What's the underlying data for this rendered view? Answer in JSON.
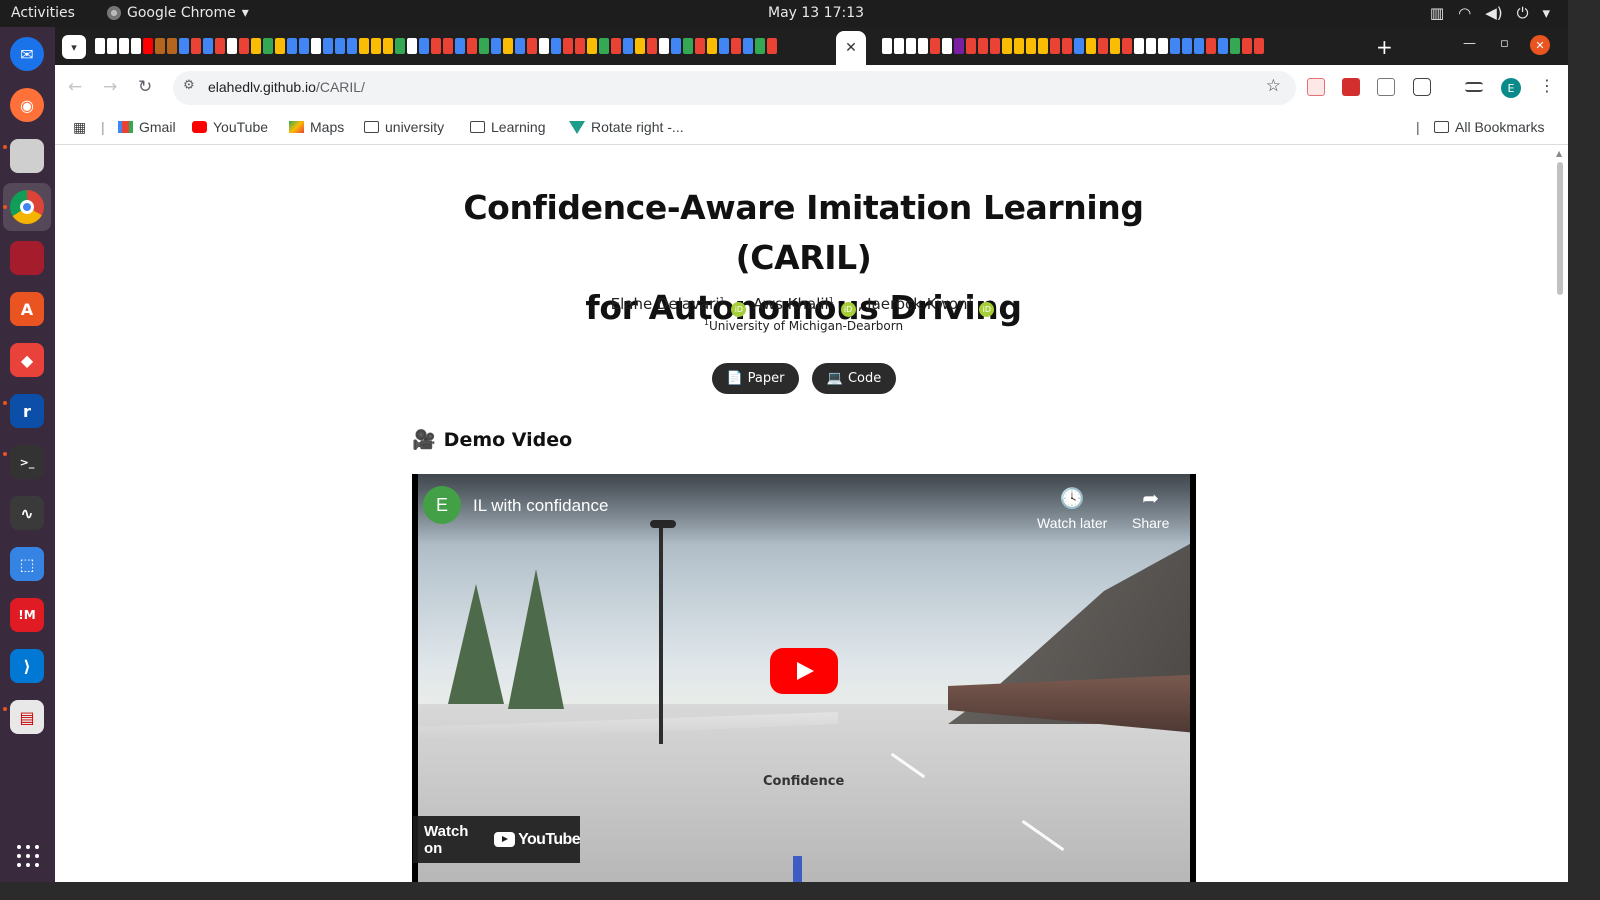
{
  "system": {
    "activities_label": "Activities",
    "app_menu_label": "Google Chrome",
    "clock": "May 13  17:13"
  },
  "browser": {
    "url_host": "elahedlv.github.io",
    "url_path": "/CARIL/",
    "profile_initial": "E",
    "bookmarks": [
      {
        "label": "Gmail",
        "icon": "gmail-icon"
      },
      {
        "label": "YouTube",
        "icon": "youtube-icon"
      },
      {
        "label": "Maps",
        "icon": "maps-icon"
      },
      {
        "label": "university",
        "icon": "folder-icon"
      },
      {
        "label": "Learning",
        "icon": "folder-icon"
      },
      {
        "label": "Rotate right -...",
        "icon": "vuetify-icon"
      }
    ],
    "all_bookmarks_label": "All Bookmarks"
  },
  "page": {
    "title_line1": "Confidence-Aware Imitation Learning (CARIL)",
    "title_line2": "for Autonomous Driving",
    "authors": [
      {
        "name": "Elahe Delavari",
        "affil": "1"
      },
      {
        "name": "Aws Khalil",
        "affil": "1"
      },
      {
        "name": "Jaerock Kwon",
        "affil": "1"
      }
    ],
    "affiliation_marker": "1",
    "affiliation": "University of Michigan-Dearborn",
    "buttons": {
      "paper_label": "Paper",
      "code_label": "Code"
    },
    "demo_heading": "Demo Video",
    "video": {
      "channel_initial": "E",
      "title": "IL with confidance",
      "watch_later": "Watch later",
      "share": "Share",
      "watch_on": "Watch on",
      "youtube_wordmark": "YouTube",
      "overlay_label": "Confidence"
    }
  }
}
